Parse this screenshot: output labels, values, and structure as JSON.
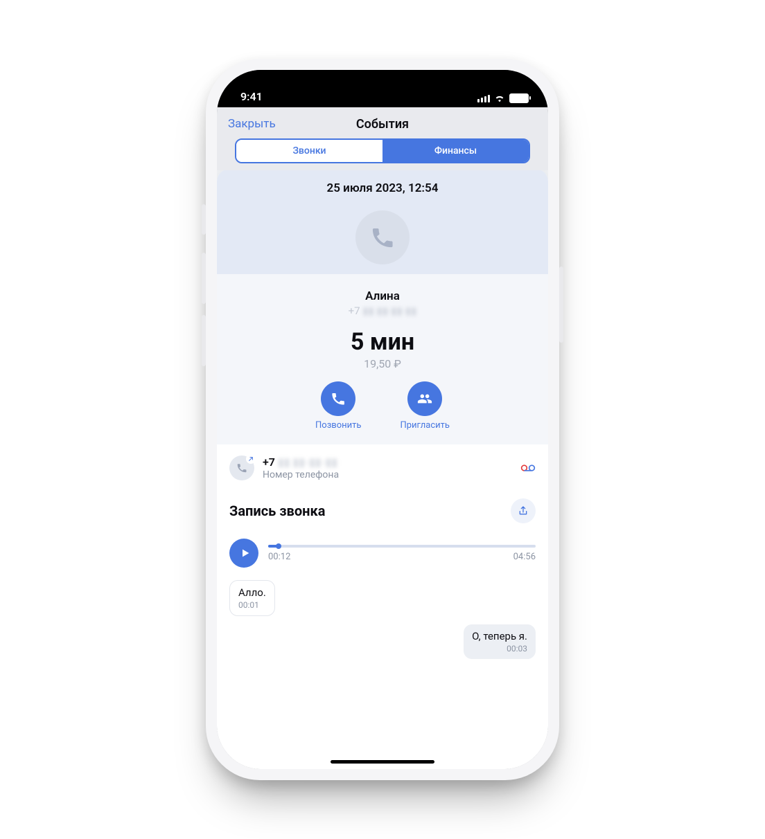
{
  "statusbar": {
    "time": "9:41"
  },
  "nav": {
    "close": "Закрыть",
    "title": "События",
    "tabs": {
      "calls": "Звонки",
      "finance": "Финансы"
    }
  },
  "detail": {
    "date": "25 июля 2023, 12:54",
    "name": "Алина",
    "phone_prefix": "+7",
    "phone_masked": "▮▮ ▮▮-▮▮-▮▮",
    "duration": "5 мин",
    "cost": "19,50 ₽",
    "actions": {
      "call": "Позвонить",
      "invite": "Пригласить"
    }
  },
  "phone_row": {
    "number_prefix": "+7",
    "number_masked": "▮▮ ▮▮-▮▮-▮▮",
    "sub": "Номер телефона"
  },
  "recording": {
    "title": "Запись звонка",
    "elapsed": "00:12",
    "total": "04:56",
    "progress_pct": 4
  },
  "transcript": [
    {
      "side": "left",
      "text": "Алло.",
      "time": "00:01"
    },
    {
      "side": "right",
      "text": "О, теперь я.",
      "time": "00:03"
    }
  ]
}
